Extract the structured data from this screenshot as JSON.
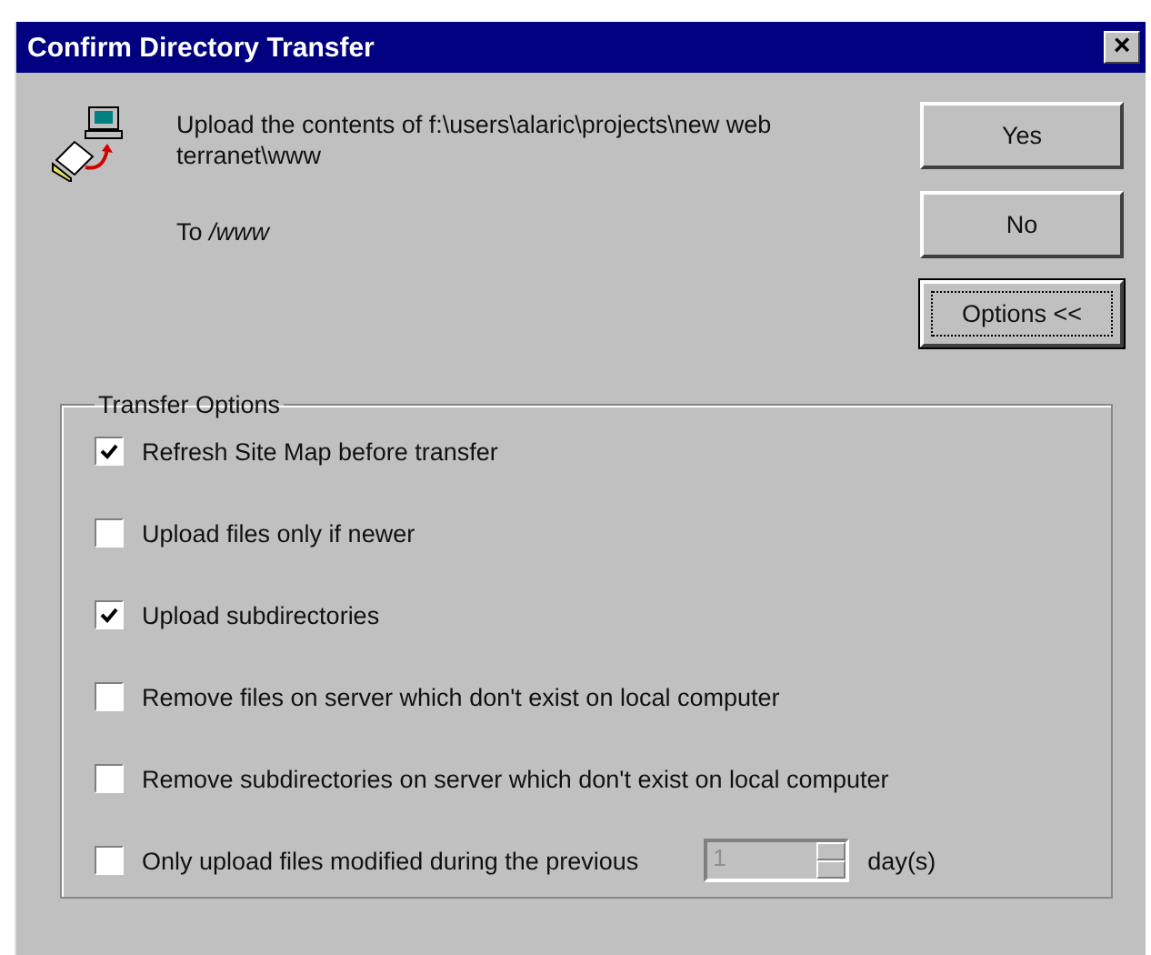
{
  "window": {
    "title": "Confirm Directory Transfer",
    "close": "×"
  },
  "message": {
    "text": "Upload the contents of f:\\users\\alaric\\projects\\new web terranet\\www",
    "destination_label": "To",
    "destination": "/www"
  },
  "buttons": [
    {
      "label": "Yes",
      "focused": false
    },
    {
      "label": "No",
      "focused": false
    },
    {
      "label": "Options <<",
      "focused": true
    }
  ],
  "group": {
    "title": "Transfer Options"
  },
  "options": [
    {
      "kind": "checkbox",
      "label": "Refresh Site Map before transfer",
      "checked": true
    },
    {
      "kind": "checkbox",
      "label": "Upload files only if newer",
      "checked": false
    },
    {
      "kind": "checkbox",
      "label": "Upload subdirectories",
      "checked": true
    },
    {
      "kind": "checkbox",
      "label": "Remove files on server which don't exist on local computer",
      "checked": false
    },
    {
      "kind": "checkbox",
      "label": "Remove subdirectories on server which don't exist on local computer",
      "checked": false
    },
    {
      "kind": "days",
      "label": "Only upload files modified during the previous",
      "checked": false,
      "value": "1",
      "disabled": true,
      "unit": "day(s)"
    }
  ]
}
